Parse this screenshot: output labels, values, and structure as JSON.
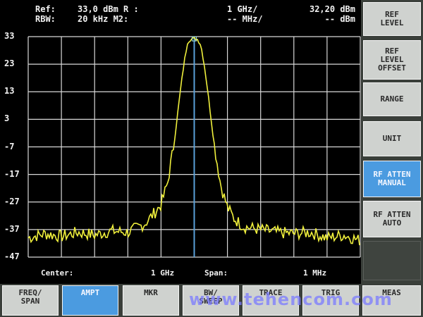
{
  "header": {
    "ref_label": "Ref:",
    "ref_value": "33,0 dBm R :",
    "rbw_label": "RBW:",
    "rbw_value": "20 kHz M2:",
    "m1_freq": "1 GHz/",
    "m1_level": "32,20 dBm",
    "m2_freq": "-- MHz/",
    "m2_level": "-- dBm"
  },
  "footer": {
    "center_label": "Center:",
    "center_value": "1 GHz",
    "span_label": "Span:",
    "span_value": "1 MHz"
  },
  "right_softkeys": [
    {
      "label": "REF\nLEVEL",
      "active": false
    },
    {
      "label": "REF\nLEVEL\nOFFSET",
      "active": false
    },
    {
      "label": "RANGE",
      "active": false
    },
    {
      "label": "UNIT",
      "active": false
    },
    {
      "label": "RF ATTEN\nMANUAL",
      "active": true
    },
    {
      "label": "RF ATTEN\nAUTO",
      "active": false
    }
  ],
  "bottom_keys": [
    {
      "label": "FREQ/\nSPAN",
      "active": false
    },
    {
      "label": "AMPT",
      "active": true
    },
    {
      "label": "MKR",
      "active": false
    },
    {
      "label": "BW/\nSWEEP",
      "active": false
    },
    {
      "label": "TRACE",
      "active": false
    },
    {
      "label": "TRIG",
      "active": false
    },
    {
      "label": "MEAS",
      "active": false
    }
  ],
  "watermark": "www.tehencom.com",
  "colors": {
    "trace": "#f0f03c",
    "marker_line": "#5aa0d8",
    "grid": "#d8d8d8",
    "active_key": "#4b9be0"
  },
  "chart_data": {
    "type": "line",
    "y_ticks": [
      "33",
      "23",
      "13",
      "3",
      "-7",
      "-17",
      "-27",
      "-37",
      "-47"
    ],
    "ylim": [
      -47,
      33
    ],
    "xlim": [
      -500,
      500
    ],
    "x_divisions": 10,
    "grid": true,
    "marker_x": 0,
    "series": [
      {
        "x": [
          -500,
          -450,
          -400,
          -350,
          -300,
          -250,
          -200,
          -150,
          -120,
          -100,
          -80,
          -60,
          -40,
          -30,
          -20,
          -10,
          0,
          10,
          20,
          30,
          40,
          60,
          80,
          100,
          120,
          150,
          200,
          250,
          300,
          350,
          400,
          450,
          500
        ],
        "values": [
          -40,
          -38.5,
          -39.5,
          -38,
          -39,
          -37.5,
          -38,
          -35,
          -31,
          -28,
          -20,
          -5,
          15,
          24,
          31,
          32.2,
          32.2,
          32,
          30,
          23,
          14,
          -6,
          -21,
          -29,
          -33,
          -36,
          -37,
          -38,
          -38.5,
          -38,
          -40,
          -39,
          -41
        ]
      }
    ]
  }
}
